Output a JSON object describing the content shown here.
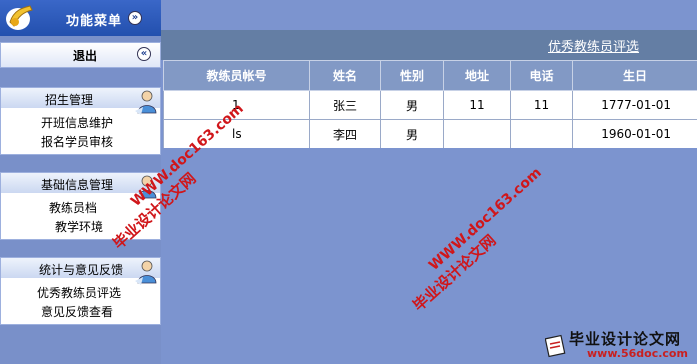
{
  "sidebar": {
    "title": "功能菜单",
    "title_toggle": "»",
    "logout": "退出",
    "logout_toggle": "«",
    "groups": [
      {
        "label": "招生管理",
        "items": [
          "开班信息维护",
          "报名学员审核"
        ]
      },
      {
        "label": "基础信息管理",
        "items": [
          "教练员档",
          "教学环境"
        ]
      },
      {
        "label": "统计与意见反馈",
        "items": [
          "优秀教练员评选",
          "意见反馈查看"
        ]
      }
    ]
  },
  "main": {
    "page_link": "优秀教练员评选",
    "columns": [
      "教练员帐号",
      "姓名",
      "性别",
      "地址",
      "电话",
      "生日"
    ],
    "rows": [
      [
        "1",
        "张三",
        "男",
        "11",
        "11",
        "1777-01-01"
      ],
      [
        "ls",
        "李四",
        "男",
        "",
        "",
        "1960-01-01"
      ]
    ]
  },
  "watermarks": {
    "site_cn": "毕业设计论文网",
    "site_url": "WWW.doc163.com",
    "corner_cn": "毕业设计论文网",
    "corner_url": "www.56doc.com"
  },
  "colors": {
    "accent": "#2350ae",
    "header_row": "#8299c5",
    "title_bar": "#647ea4",
    "watermark": "#d0161a"
  }
}
